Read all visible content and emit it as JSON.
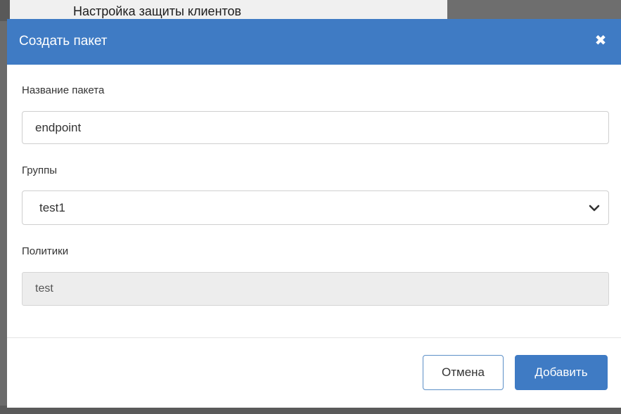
{
  "background": {
    "section_title": "Настройка защиты клиентов"
  },
  "dialog": {
    "title": "Создать пакет",
    "close_icon": "close-icon",
    "fields": {
      "package_name": {
        "label": "Название пакета",
        "value": "endpoint"
      },
      "groups": {
        "label": "Группы",
        "selected": "test1"
      },
      "policies": {
        "label": "Политики",
        "value": "test"
      }
    },
    "buttons": {
      "cancel": "Отмена",
      "add": "Добавить"
    }
  },
  "colors": {
    "accent": "#3f7bc4",
    "readonly_bg": "#ededed"
  }
}
